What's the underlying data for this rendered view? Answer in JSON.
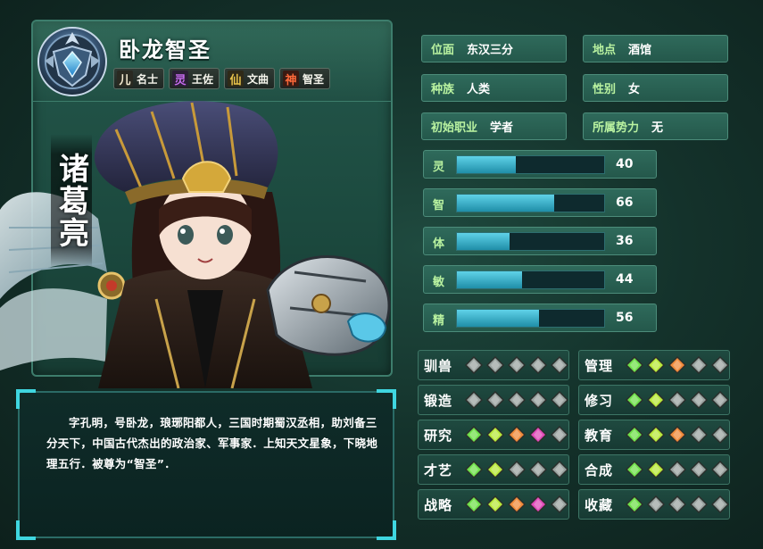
{
  "character": {
    "title": "卧龙智圣",
    "vertical_name": "诸葛亮",
    "tags": [
      {
        "icon_char": "儿",
        "icon_color": "#f2e9d0",
        "icon_bg": "#2a2a22",
        "label": "名士"
      },
      {
        "icon_char": "灵",
        "icon_color": "#c86cf0",
        "icon_bg": "#2a1f35",
        "label": "王佐"
      },
      {
        "icon_char": "仙",
        "icon_color": "#e7c24a",
        "icon_bg": "#2f2a18",
        "label": "文曲"
      },
      {
        "icon_char": "神",
        "icon_color": "#ff6a3a",
        "icon_bg": "#3a1a12",
        "label": "智圣"
      }
    ],
    "description": "字孔明，号卧龙，琅琊阳都人，三国时期蜀汉丞相，助刘备三分天下，中国古代杰出的政治家、军事家．上知天文星象，下晓地理五行．被尊为“智圣”．"
  },
  "info": [
    {
      "key": "位面",
      "value": "东汉三分"
    },
    {
      "key": "地点",
      "value": "酒馆"
    },
    {
      "key": "种族",
      "value": "人类"
    },
    {
      "key": "性别",
      "value": "女"
    },
    {
      "key": "初始职业",
      "value": "学者"
    },
    {
      "key": "所属势力",
      "value": "无"
    }
  ],
  "stats": [
    {
      "key": "灵",
      "value": "40",
      "fraction": 0.4
    },
    {
      "key": "智",
      "value": "66",
      "fraction": 0.66
    },
    {
      "key": "体",
      "value": "36",
      "fraction": 0.36
    },
    {
      "key": "敏",
      "value": "44",
      "fraction": 0.44
    },
    {
      "key": "精",
      "value": "56",
      "fraction": 0.56
    }
  ],
  "gem_colors": {
    "grey": "#9aa3a0",
    "green": "#6fe04a",
    "yellow": "#b8e83a",
    "orange": "#f08a3a",
    "pink": "#e04ab8"
  },
  "skills": [
    {
      "name": "驯兽",
      "gems": [
        "grey",
        "grey",
        "grey",
        "grey",
        "grey"
      ]
    },
    {
      "name": "管理",
      "gems": [
        "green",
        "yellow",
        "orange",
        "grey",
        "grey"
      ]
    },
    {
      "name": "锻造",
      "gems": [
        "grey",
        "grey",
        "grey",
        "grey",
        "grey"
      ]
    },
    {
      "name": "修习",
      "gems": [
        "green",
        "yellow",
        "grey",
        "grey",
        "grey"
      ]
    },
    {
      "name": "研究",
      "gems": [
        "green",
        "yellow",
        "orange",
        "pink",
        "grey"
      ]
    },
    {
      "name": "教育",
      "gems": [
        "green",
        "yellow",
        "orange",
        "grey",
        "grey"
      ]
    },
    {
      "name": "才艺",
      "gems": [
        "green",
        "yellow",
        "grey",
        "grey",
        "grey"
      ]
    },
    {
      "name": "合成",
      "gems": [
        "green",
        "yellow",
        "grey",
        "grey",
        "grey"
      ]
    },
    {
      "name": "战略",
      "gems": [
        "green",
        "yellow",
        "orange",
        "pink",
        "grey"
      ]
    },
    {
      "name": "收藏",
      "gems": [
        "green",
        "grey",
        "grey",
        "grey",
        "grey"
      ]
    }
  ]
}
